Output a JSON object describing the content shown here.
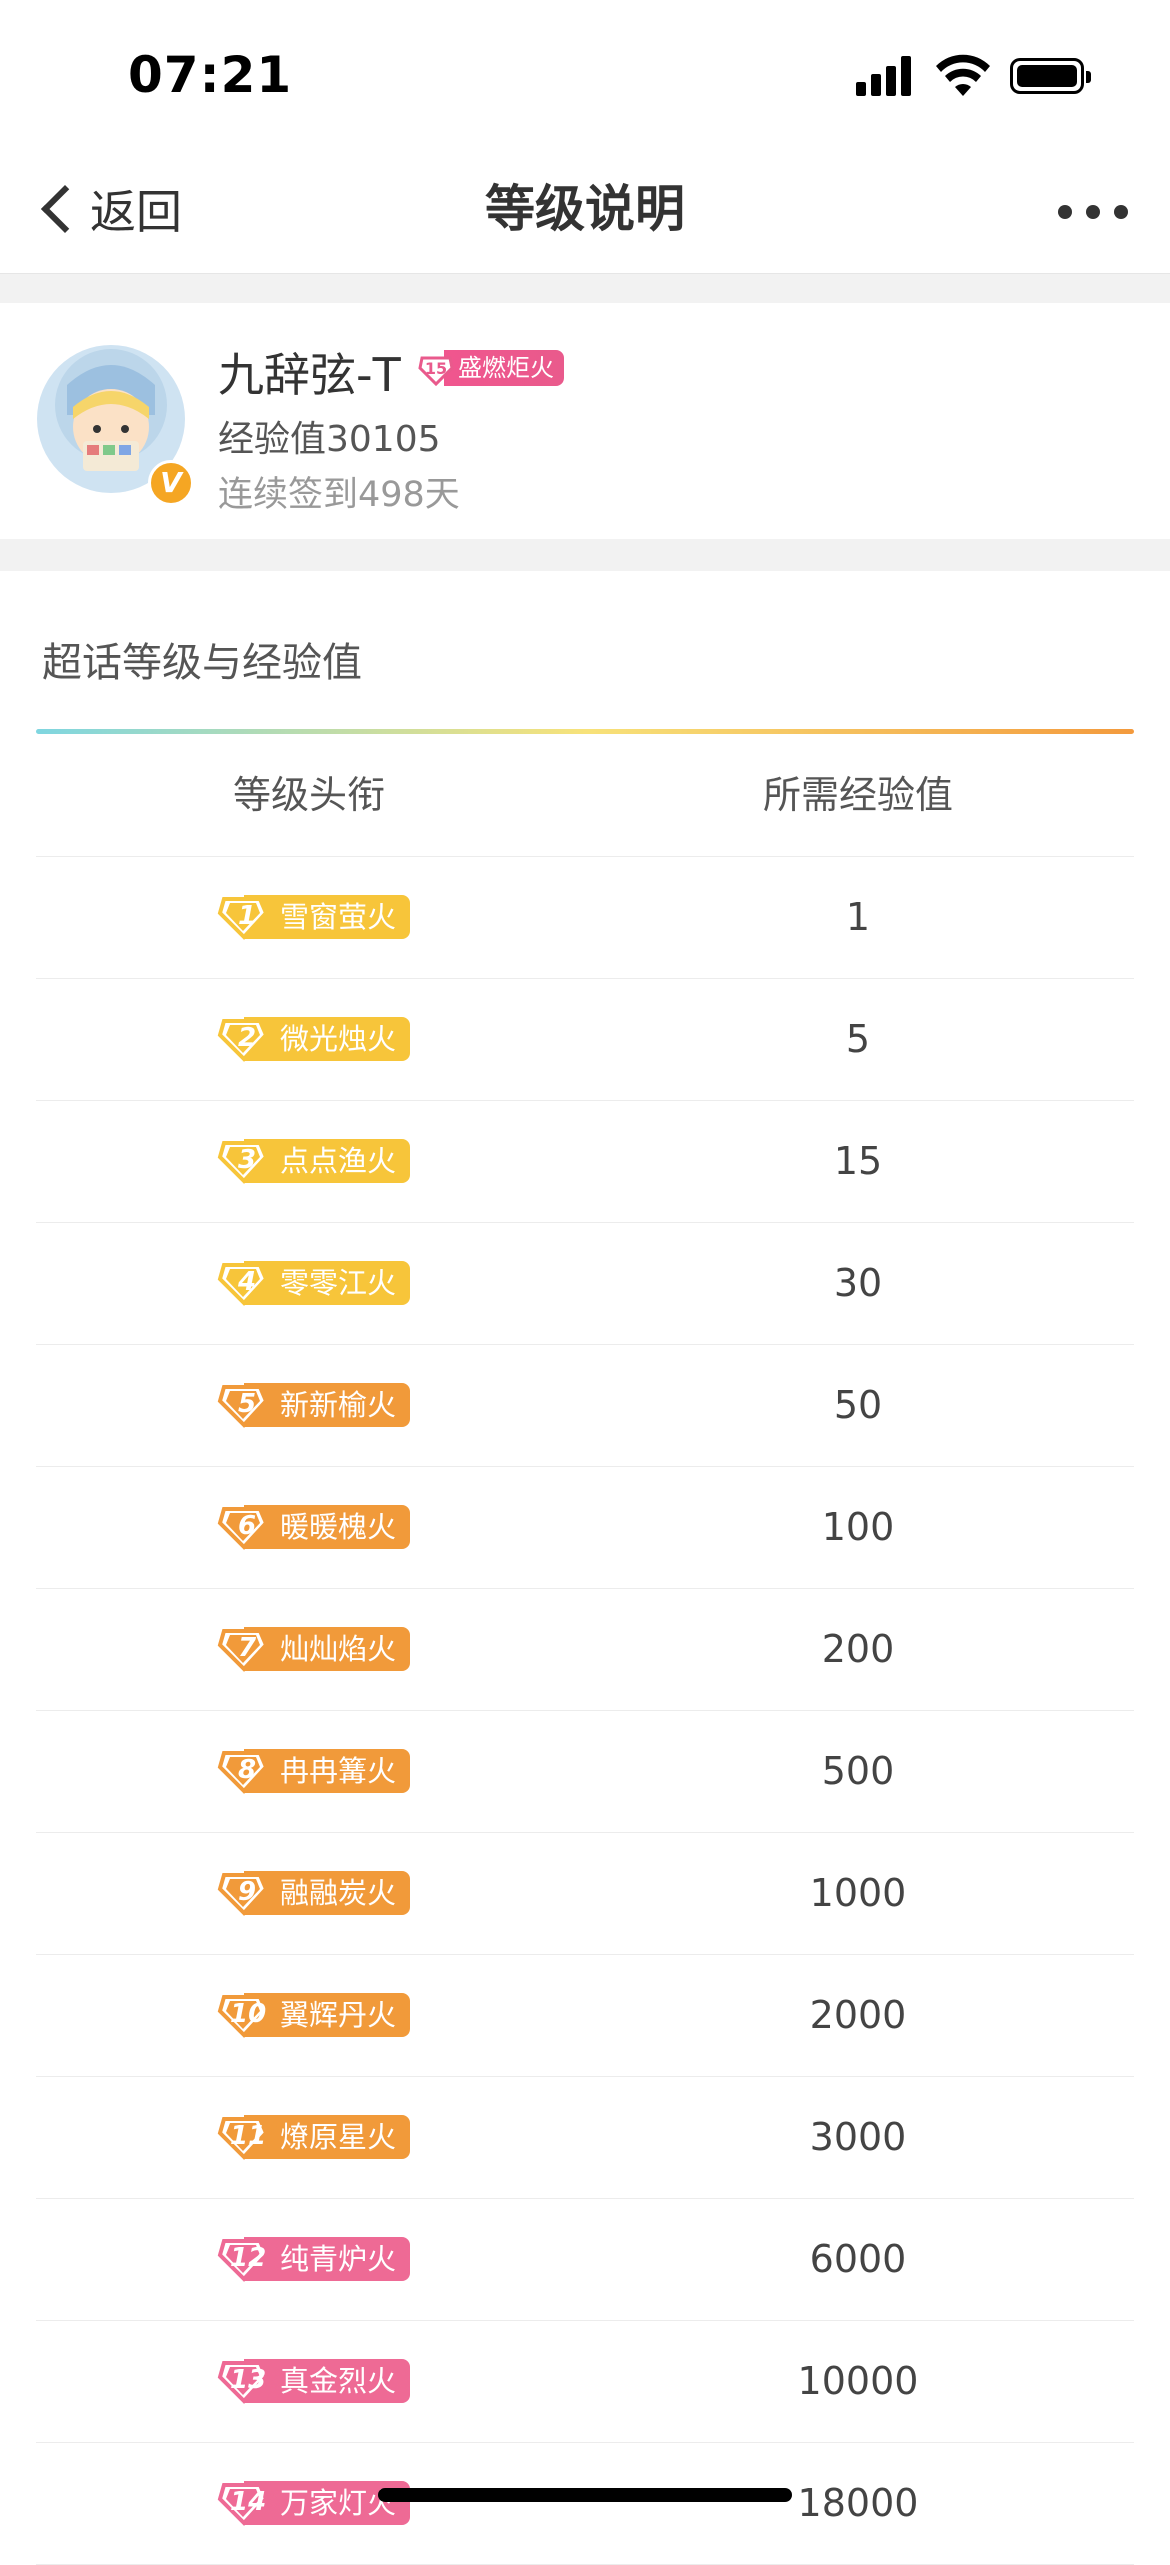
{
  "status": {
    "time": "07:21"
  },
  "nav": {
    "back_label": "返回",
    "title": "等级说明"
  },
  "profile": {
    "username": "九辞弦-T",
    "level_num": "15",
    "level_title": "盛燃炬火",
    "experience": "经验值30105",
    "checkin": "连续签到498天"
  },
  "section": {
    "title": "超话等级与经验值"
  },
  "table": {
    "headers": [
      "等级头衔",
      "所需经验值"
    ],
    "rows": [
      {
        "num": "1",
        "title": "雪窗萤火",
        "exp": "1",
        "color": "#f7c53a"
      },
      {
        "num": "2",
        "title": "微光烛火",
        "exp": "5",
        "color": "#f7c53a"
      },
      {
        "num": "3",
        "title": "点点渔火",
        "exp": "15",
        "color": "#f7c53a"
      },
      {
        "num": "4",
        "title": "零零江火",
        "exp": "30",
        "color": "#f7c53a"
      },
      {
        "num": "5",
        "title": "新新榆火",
        "exp": "50",
        "color": "#f19a3a"
      },
      {
        "num": "6",
        "title": "暖暖槐火",
        "exp": "100",
        "color": "#f19a3a"
      },
      {
        "num": "7",
        "title": "灿灿焰火",
        "exp": "200",
        "color": "#f19a3a"
      },
      {
        "num": "8",
        "title": "冉冉篝火",
        "exp": "500",
        "color": "#f19a3a"
      },
      {
        "num": "9",
        "title": "融融炭火",
        "exp": "1000",
        "color": "#f19a3a"
      },
      {
        "num": "10",
        "title": "翼辉丹火",
        "exp": "2000",
        "color": "#f19a3a"
      },
      {
        "num": "11",
        "title": "燎原星火",
        "exp": "3000",
        "color": "#f19a3a"
      },
      {
        "num": "12",
        "title": "纯青炉火",
        "exp": "6000",
        "color": "#ee6a95"
      },
      {
        "num": "13",
        "title": "真金烈火",
        "exp": "10000",
        "color": "#ee6a95"
      },
      {
        "num": "14",
        "title": "万家灯火",
        "exp": "18000",
        "color": "#ee6a95"
      }
    ]
  }
}
